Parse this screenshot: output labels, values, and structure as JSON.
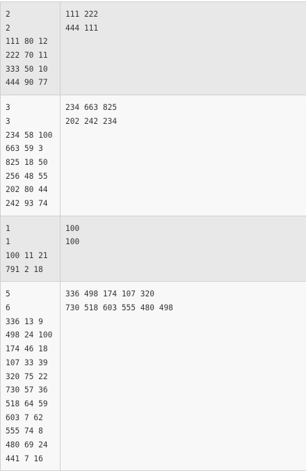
{
  "rows": [
    {
      "input": [
        "2",
        "2",
        "111 80 12",
        "222 70 11",
        "333 50 10",
        "444 90 77"
      ],
      "output": [
        "111 222",
        "444 111"
      ]
    },
    {
      "input": [
        "3",
        "3",
        "234 58 100",
        "663 59 3",
        "825 18 50",
        "256 48 55",
        "202 80 44",
        "242 93 74"
      ],
      "output": [
        "234 663 825",
        "202 242 234"
      ]
    },
    {
      "input": [
        "1",
        "1",
        "100 11 21",
        "791 2 18"
      ],
      "output": [
        "100",
        "100"
      ]
    },
    {
      "input": [
        "5",
        "6",
        "336 13 9",
        "498 24 100",
        "174 46 18",
        "107 33 39",
        "320 75 22",
        "730 57 36",
        "518 64 59",
        "603 7 62",
        "555 74 8",
        "480 69 24",
        "441 7 16"
      ],
      "output": [
        "336 498 174 107 320",
        "730 518 603 555 480 498"
      ]
    }
  ]
}
